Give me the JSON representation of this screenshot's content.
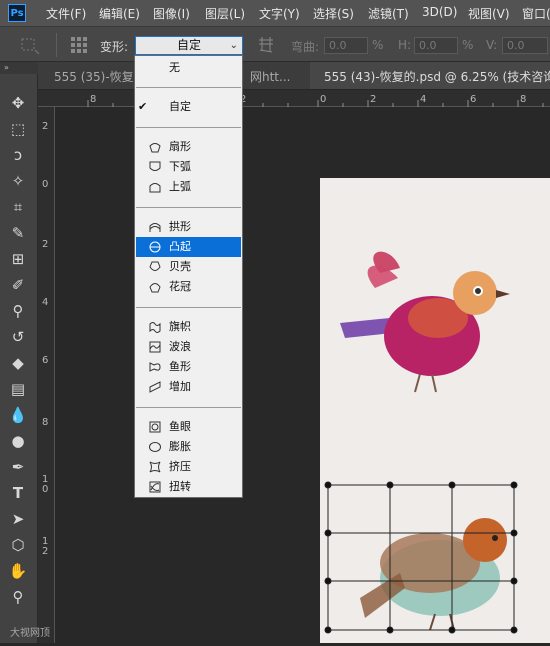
{
  "app": {
    "logo": "Ps"
  },
  "menus": [
    "文件(F)",
    "编辑(E)",
    "图像(I)",
    "图层(L)",
    "文字(Y)",
    "选择(S)",
    "滤镜(T)",
    "3D(D)",
    "视图(V)",
    "窗口("
  ],
  "options_bar": {
    "warp_label": "变形:",
    "warp_value": "自定",
    "bend_label": "弯曲:",
    "bend_value": "0.0",
    "bend_unit": "%",
    "h_label": "H:",
    "h_value": "0.0",
    "h_unit": "%",
    "v_label": "V:",
    "v_value": "0.0"
  },
  "tabs": [
    {
      "label": "555 (35)-恢复的"
    },
    {
      "label": "网htt..."
    },
    {
      "label": "555 (43)-恢复的.psd @ 6.25% (技术咨询,"
    }
  ],
  "rulers": {
    "h": [
      "8",
      "6",
      "4",
      "2",
      "0",
      "2",
      "4",
      "6",
      "8"
    ],
    "v": [
      "2",
      "0",
      "2",
      "4",
      "6",
      "8",
      "1 0",
      "1 2"
    ]
  },
  "dropdown": {
    "groups": [
      [
        {
          "label": "无",
          "icon": "none"
        }
      ],
      [
        {
          "label": "自定",
          "icon": "checkmark-icon",
          "checked": true
        }
      ],
      [
        {
          "label": "扇形",
          "icon": "arc-icon"
        },
        {
          "label": "下弧",
          "icon": "arc-lower-icon"
        },
        {
          "label": "上弧",
          "icon": "arc-upper-icon"
        }
      ],
      [
        {
          "label": "拱形",
          "icon": "arch-icon"
        },
        {
          "label": "凸起",
          "icon": "bulge-icon",
          "selected": true
        },
        {
          "label": "贝壳",
          "icon": "shell-lower-icon"
        },
        {
          "label": "花冠",
          "icon": "shell-upper-icon"
        }
      ],
      [
        {
          "label": "旗帜",
          "icon": "flag-icon"
        },
        {
          "label": "波浪",
          "icon": "wave-icon"
        },
        {
          "label": "鱼形",
          "icon": "fish-icon"
        },
        {
          "label": "增加",
          "icon": "rise-icon"
        }
      ],
      [
        {
          "label": "鱼眼",
          "icon": "fisheye-icon"
        },
        {
          "label": "膨胀",
          "icon": "inflate-icon"
        },
        {
          "label": "挤压",
          "icon": "squeeze-icon"
        },
        {
          "label": "扭转",
          "icon": "twist-icon"
        }
      ]
    ]
  },
  "watermark": "大视网顶",
  "colors": {
    "menu_bg": "#535353",
    "highlight": "#0a6fd6",
    "canvas": "#efecea"
  }
}
